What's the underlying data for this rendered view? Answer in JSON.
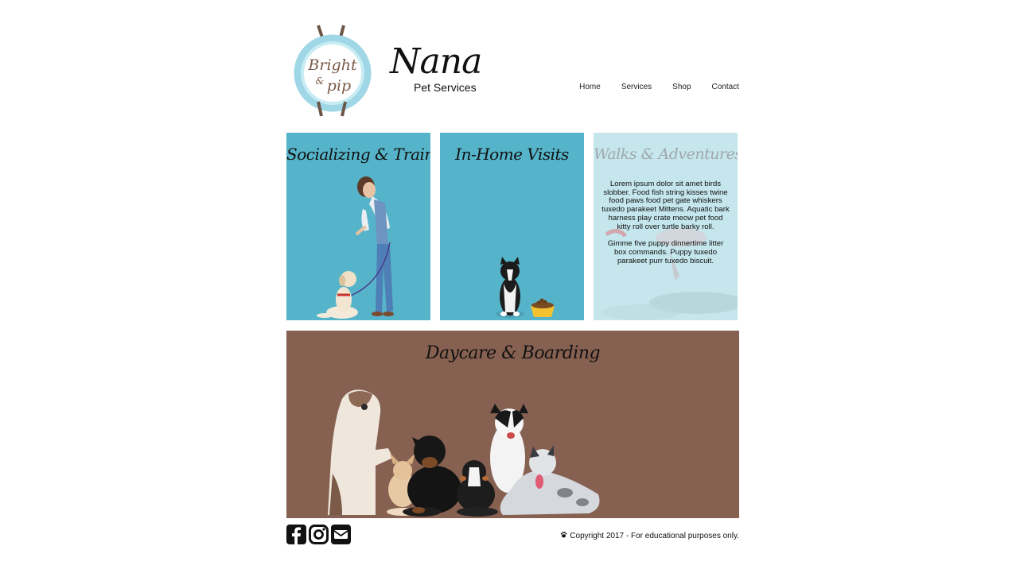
{
  "header": {
    "logo_primary": {
      "line1": "Bright",
      "line2": "&",
      "line3": "pip"
    },
    "logo_secondary": {
      "title": "Nana",
      "subtitle": "Pet Services"
    },
    "nav": [
      "Home",
      "Services",
      "Shop",
      "Contact"
    ]
  },
  "services": [
    {
      "title": "Socializing & Training",
      "image": "trainer-with-puppy"
    },
    {
      "title": "In-Home Visits",
      "image": "dog-with-food-bowl"
    },
    {
      "title": "Walks & Adventures",
      "description": [
        "Lorem ipsum dolor sit amet birds slobber. Food fish string kisses twine food paws food pet gate whiskers tuxedo parakeet Mittens. Aquatic bark harness play crate meow pet food kitty roll over turtle barky roll.",
        "Gimme five puppy dinnertime litter box commands. Puppy tuxedo parakeet purr tuxedo biscuit."
      ]
    }
  ],
  "banner": {
    "title": "Daycare & Boarding",
    "image": "group-of-dogs"
  },
  "footer": {
    "social": [
      "facebook-icon",
      "instagram-icon",
      "email-icon"
    ],
    "copyright_icon": "paw-icon",
    "copyright": "Copyright 2017 - For educational purposes only."
  },
  "colors": {
    "tile_blue": "#55b4c9",
    "tile_light": "#c4e6ec",
    "banner_brown": "#866050"
  }
}
